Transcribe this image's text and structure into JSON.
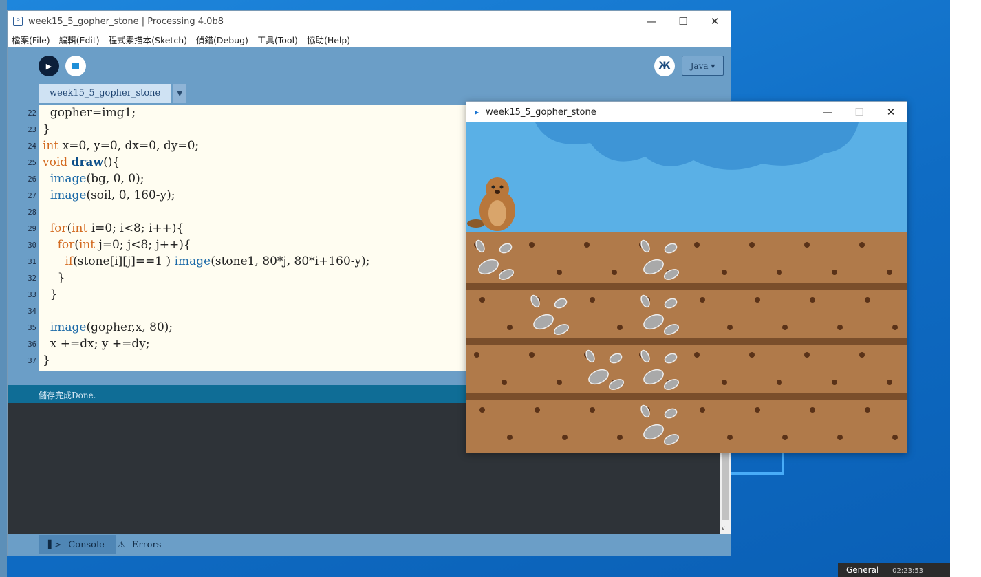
{
  "desktop": {
    "taskbar_label": "General",
    "taskbar_time": "02:23:53"
  },
  "ide": {
    "title": "week15_5_gopher_stone | Processing 4.0b8",
    "menu": [
      "檔案(File)",
      "編輯(Edit)",
      "程式素描本(Sketch)",
      "偵錯(Debug)",
      "工具(Tool)",
      "協助(Help)"
    ],
    "mode": "Java ▾",
    "tab_name": "week15_5_gopher_stone",
    "status": "儲存完成Done.",
    "bottom_tabs": {
      "console": "Console",
      "errors": "Errors"
    },
    "code_lines": [
      {
        "n": "22",
        "t": "  gopher=img1;"
      },
      {
        "n": "23",
        "t": "}"
      },
      {
        "n": "24",
        "t": "int x=0, y=0, dx=0, dy=0;"
      },
      {
        "n": "25",
        "t": "void draw(){"
      },
      {
        "n": "26",
        "t": "  image(bg, 0, 0);"
      },
      {
        "n": "27",
        "t": "  image(soil, 0, 160-y);"
      },
      {
        "n": "28",
        "t": ""
      },
      {
        "n": "29",
        "t": "  for(int i=0; i<8; i++){"
      },
      {
        "n": "30",
        "t": "    for(int j=0; j<8; j++){"
      },
      {
        "n": "31",
        "t": "      if(stone[i][j]==1 ) image(stone1, 80*j, 80*i+160-y);"
      },
      {
        "n": "32",
        "t": "    }"
      },
      {
        "n": "33",
        "t": "  }"
      },
      {
        "n": "34",
        "t": ""
      },
      {
        "n": "35",
        "t": "  image(gopher,x, 80);"
      },
      {
        "n": "36",
        "t": "  x +=dx; y +=dy;"
      },
      {
        "n": "37",
        "t": "}"
      }
    ]
  },
  "sketch": {
    "title": "week15_5_gopher_stone",
    "colors": {
      "sky": "#5ab0e6",
      "soil": "#b07a4a",
      "soil_dark": "#7a4e2b",
      "stone": "#a9a9a9"
    },
    "stone_grid": [
      [
        1,
        0,
        0,
        1,
        0,
        0,
        0,
        0
      ],
      [
        0,
        1,
        0,
        1,
        0,
        0,
        0,
        0
      ],
      [
        0,
        0,
        1,
        1,
        0,
        0,
        0,
        0
      ],
      [
        0,
        0,
        0,
        1,
        0,
        0,
        0,
        0
      ]
    ]
  }
}
